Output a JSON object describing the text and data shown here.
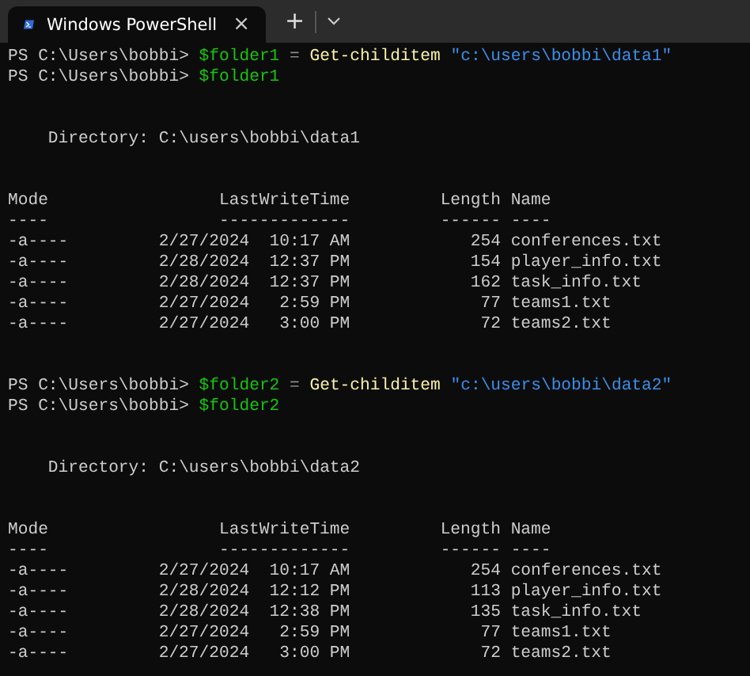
{
  "tabs": [
    {
      "title": "Windows PowerShell",
      "close": "×",
      "selected": true
    }
  ],
  "new_tab": "+",
  "sessions": [
    {
      "commands": [
        {
          "prompt": "PS C:\\Users\\bobbi>",
          "tokens": [
            {
              "kind": "variable",
              "text": "$folder1"
            },
            {
              "kind": "operator",
              "text": "="
            },
            {
              "kind": "cmdlet",
              "text": "Get-childitem"
            },
            {
              "kind": "string",
              "text": "\"c:\\users\\bobbi\\data1\""
            }
          ]
        },
        {
          "prompt": "PS C:\\Users\\bobbi>",
          "tokens": [
            {
              "kind": "variable",
              "text": "$folder1"
            }
          ]
        }
      ],
      "directory": "Directory: C:\\users\\bobbi\\data1",
      "columns": [
        {
          "label": "Mode",
          "rule": "----"
        },
        {
          "label": "LastWriteTime",
          "rule": "-------------"
        },
        {
          "label": "Length",
          "rule": "------"
        },
        {
          "label": "Name",
          "rule": "----"
        }
      ],
      "rows": [
        [
          "-a----",
          "2/27/2024  10:17 AM",
          "254",
          "conferences.txt"
        ],
        [
          "-a----",
          "2/28/2024  12:37 PM",
          "154",
          "player_info.txt"
        ],
        [
          "-a----",
          "2/28/2024  12:37 PM",
          "162",
          "task_info.txt"
        ],
        [
          "-a----",
          "2/27/2024   2:59 PM",
          "77",
          "teams1.txt"
        ],
        [
          "-a----",
          "2/27/2024   3:00 PM",
          "72",
          "teams2.txt"
        ]
      ]
    },
    {
      "commands": [
        {
          "prompt": "PS C:\\Users\\bobbi>",
          "tokens": [
            {
              "kind": "variable",
              "text": "$folder2"
            },
            {
              "kind": "operator",
              "text": "="
            },
            {
              "kind": "cmdlet",
              "text": "Get-childitem"
            },
            {
              "kind": "string",
              "text": "\"c:\\users\\bobbi\\data2\""
            }
          ]
        },
        {
          "prompt": "PS C:\\Users\\bobbi>",
          "tokens": [
            {
              "kind": "variable",
              "text": "$folder2"
            }
          ]
        }
      ],
      "directory": "Directory: C:\\users\\bobbi\\data2",
      "columns": [
        {
          "label": "Mode",
          "rule": "----"
        },
        {
          "label": "LastWriteTime",
          "rule": "-------------"
        },
        {
          "label": "Length",
          "rule": "------"
        },
        {
          "label": "Name",
          "rule": "----"
        }
      ],
      "rows": [
        [
          "-a----",
          "2/27/2024  10:17 AM",
          "254",
          "conferences.txt"
        ],
        [
          "-a----",
          "2/28/2024  12:12 PM",
          "113",
          "player_info.txt"
        ],
        [
          "-a----",
          "2/28/2024  12:38 PM",
          "135",
          "task_info.txt"
        ],
        [
          "-a----",
          "2/27/2024   2:59 PM",
          "77",
          "teams1.txt"
        ],
        [
          "-a----",
          "2/27/2024   3:00 PM",
          "72",
          "teams2.txt"
        ]
      ]
    }
  ]
}
